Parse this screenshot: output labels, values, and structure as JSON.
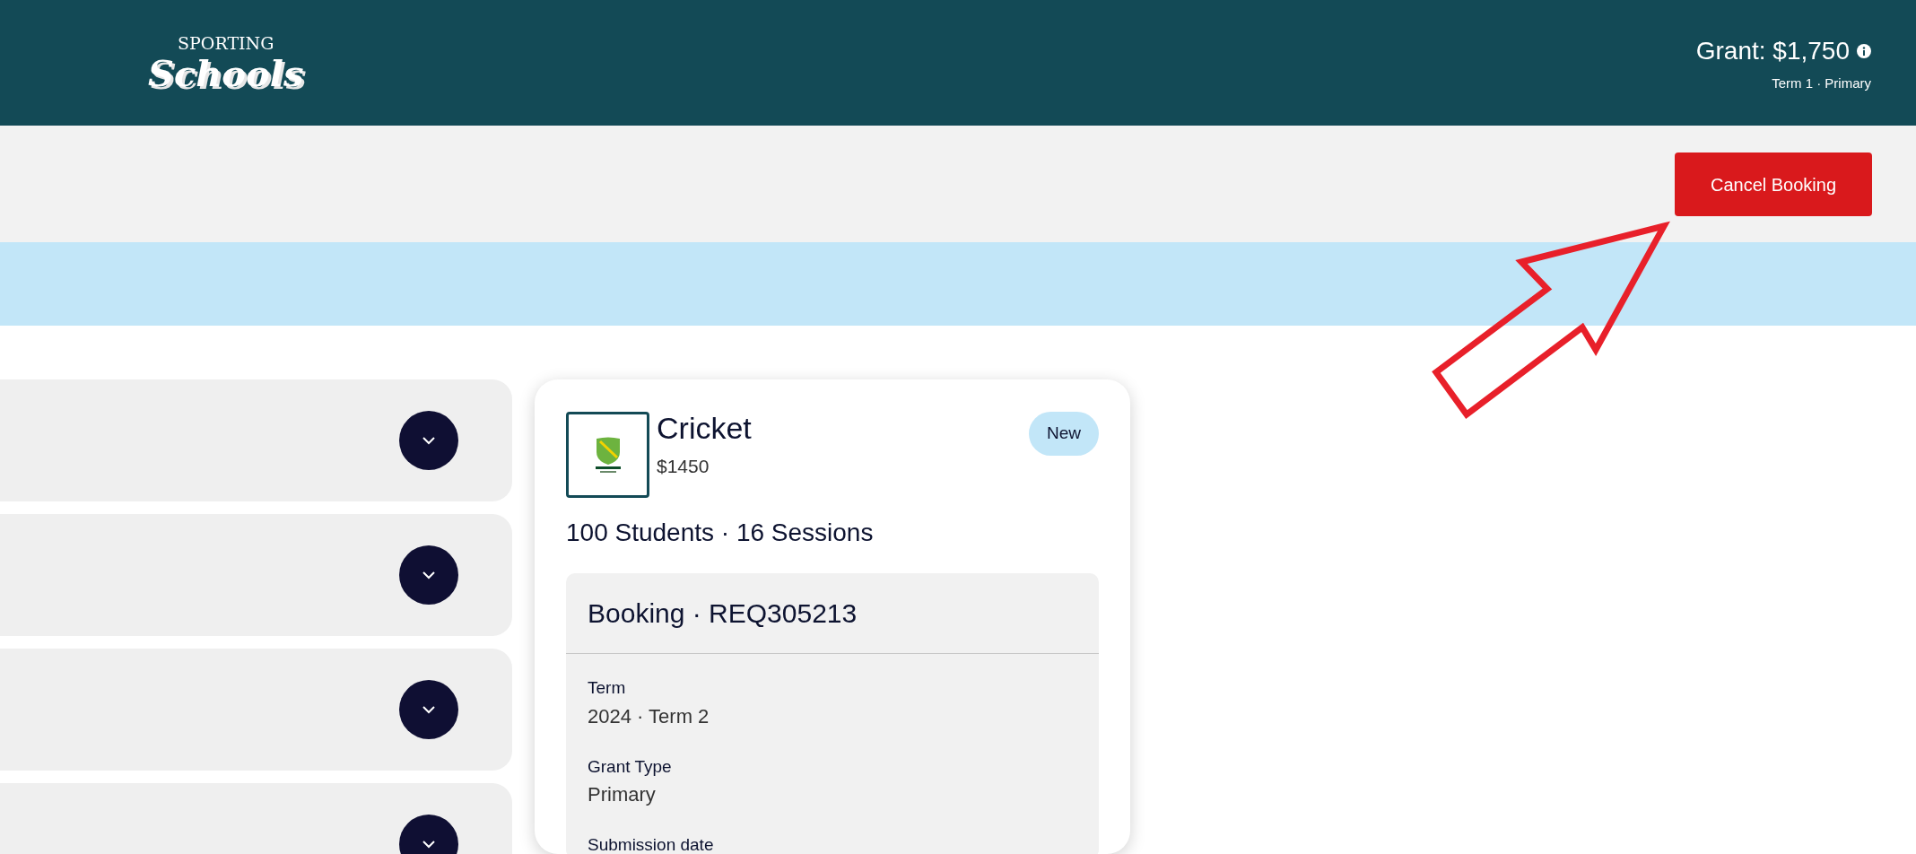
{
  "header": {
    "logo": {
      "top": "SPORTING",
      "bottom": "Schools"
    },
    "grant": "Grant: $1,750",
    "grant_detail": "Term 1 · Primary"
  },
  "toolbar": {
    "buttons": [
      {
        "label": "Cancel Booking",
        "kind": "danger"
      }
    ]
  },
  "accordion": [
    {
      "expanded": false
    },
    {
      "expanded": false
    },
    {
      "expanded": false
    },
    {
      "expanded": false
    }
  ],
  "card": {
    "title": "Cricket",
    "price": "$1450",
    "badge": "New",
    "summary": "100 Students · 16 Sessions",
    "booking": {
      "title": "Booking · REQ305213",
      "fields": [
        {
          "label": "Term",
          "value": "2024 · Term 2"
        },
        {
          "label": "Grant Type",
          "value": "Primary"
        },
        {
          "label": "Submission date"
        }
      ]
    }
  }
}
